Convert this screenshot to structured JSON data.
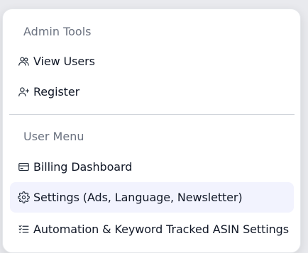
{
  "admin_section": {
    "title": "Admin Tools",
    "items": [
      {
        "label": "View Users",
        "icon": "users-icon"
      },
      {
        "label": "Register",
        "icon": "user-plus-icon"
      }
    ]
  },
  "user_section": {
    "title": "User Menu",
    "items": [
      {
        "label": "Billing Dashboard",
        "icon": "credit-card-icon"
      },
      {
        "label": "Settings (Ads, Language, Newsletter)",
        "icon": "gear-icon",
        "highlighted": true
      },
      {
        "label": "Automation & Keyword Tracked ASIN Settings",
        "icon": "list-checks-icon"
      }
    ]
  },
  "colors": {
    "highlight": "#f2f3fe",
    "section_title": "#6b7280",
    "text": "#111827"
  }
}
